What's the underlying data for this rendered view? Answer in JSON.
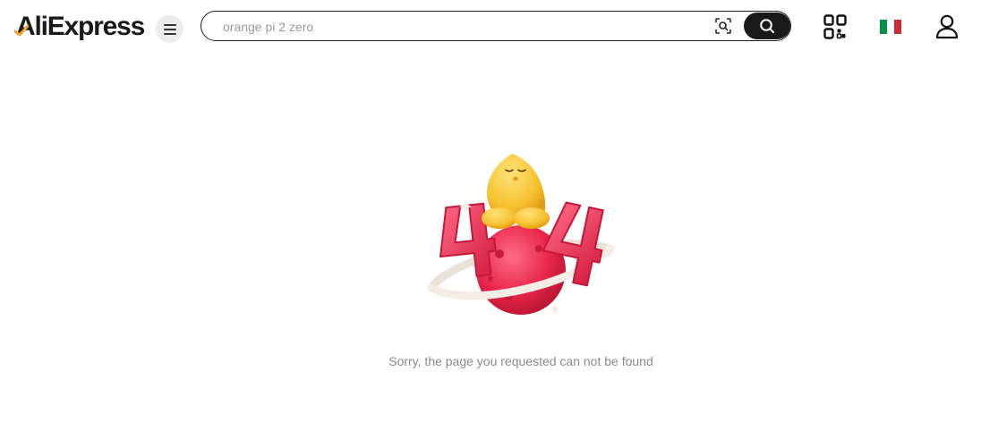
{
  "header": {
    "logo_text": "AliExpress",
    "search": {
      "placeholder": "orange pi 2 zero"
    },
    "icons": {
      "menu": "menu-icon",
      "camera": "camera-search-icon",
      "search": "search-icon",
      "qr": "qr-code-icon",
      "flag": "italy-flag-icon",
      "account": "user-icon"
    }
  },
  "error": {
    "illustration_label": "404",
    "message": "Sorry, the page you requested can not be found"
  },
  "colors": {
    "brand_dark": "#191919",
    "accent_red": "#e8264a",
    "mascot_yellow": "#f5c230",
    "flag_green": "#009246",
    "flag_white": "#ffffff",
    "flag_red": "#ce2b37",
    "message_gray": "#8a8a8a"
  }
}
